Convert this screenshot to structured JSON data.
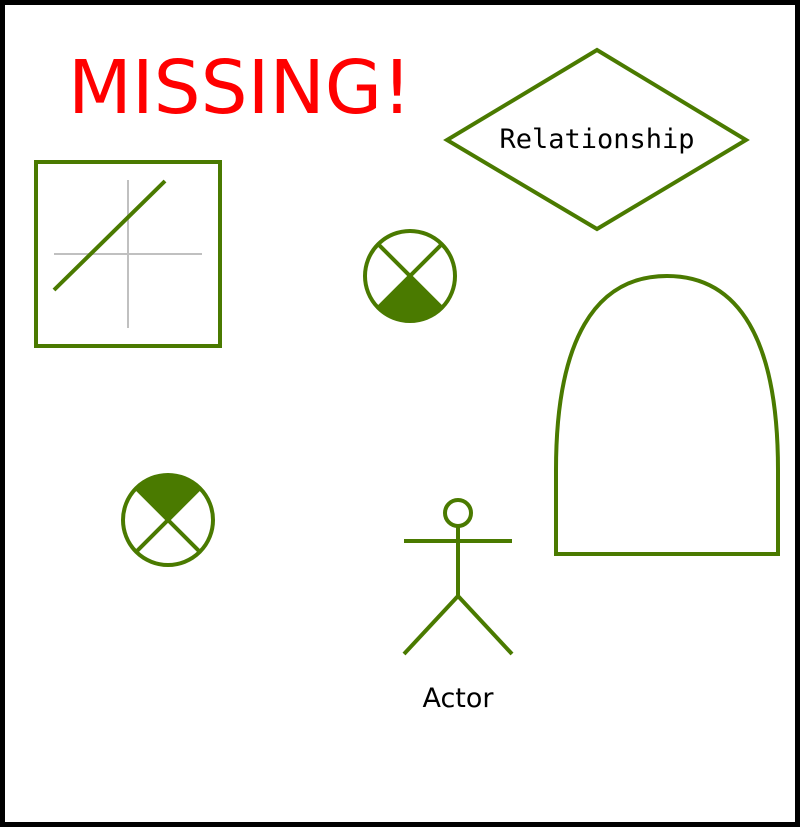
{
  "missing": {
    "label": "MISSING!"
  },
  "relationship": {
    "label": "Relationship"
  },
  "actor": {
    "label": "Actor"
  },
  "icons": {
    "missing_label": "warning-text",
    "chart": "line-chart-icon",
    "relationship": "diamond-shape",
    "tombstone": "arch-shape",
    "actor": "stick-figure-icon",
    "crossed_circle": "crossed-circle-icon"
  },
  "colors": {
    "frame": "#000000",
    "shape_stroke": "#4a7a00",
    "shape_fill": "#4a7a00",
    "axis": "#c0c0c0",
    "missing": "#ff0000",
    "text": "#000000"
  }
}
